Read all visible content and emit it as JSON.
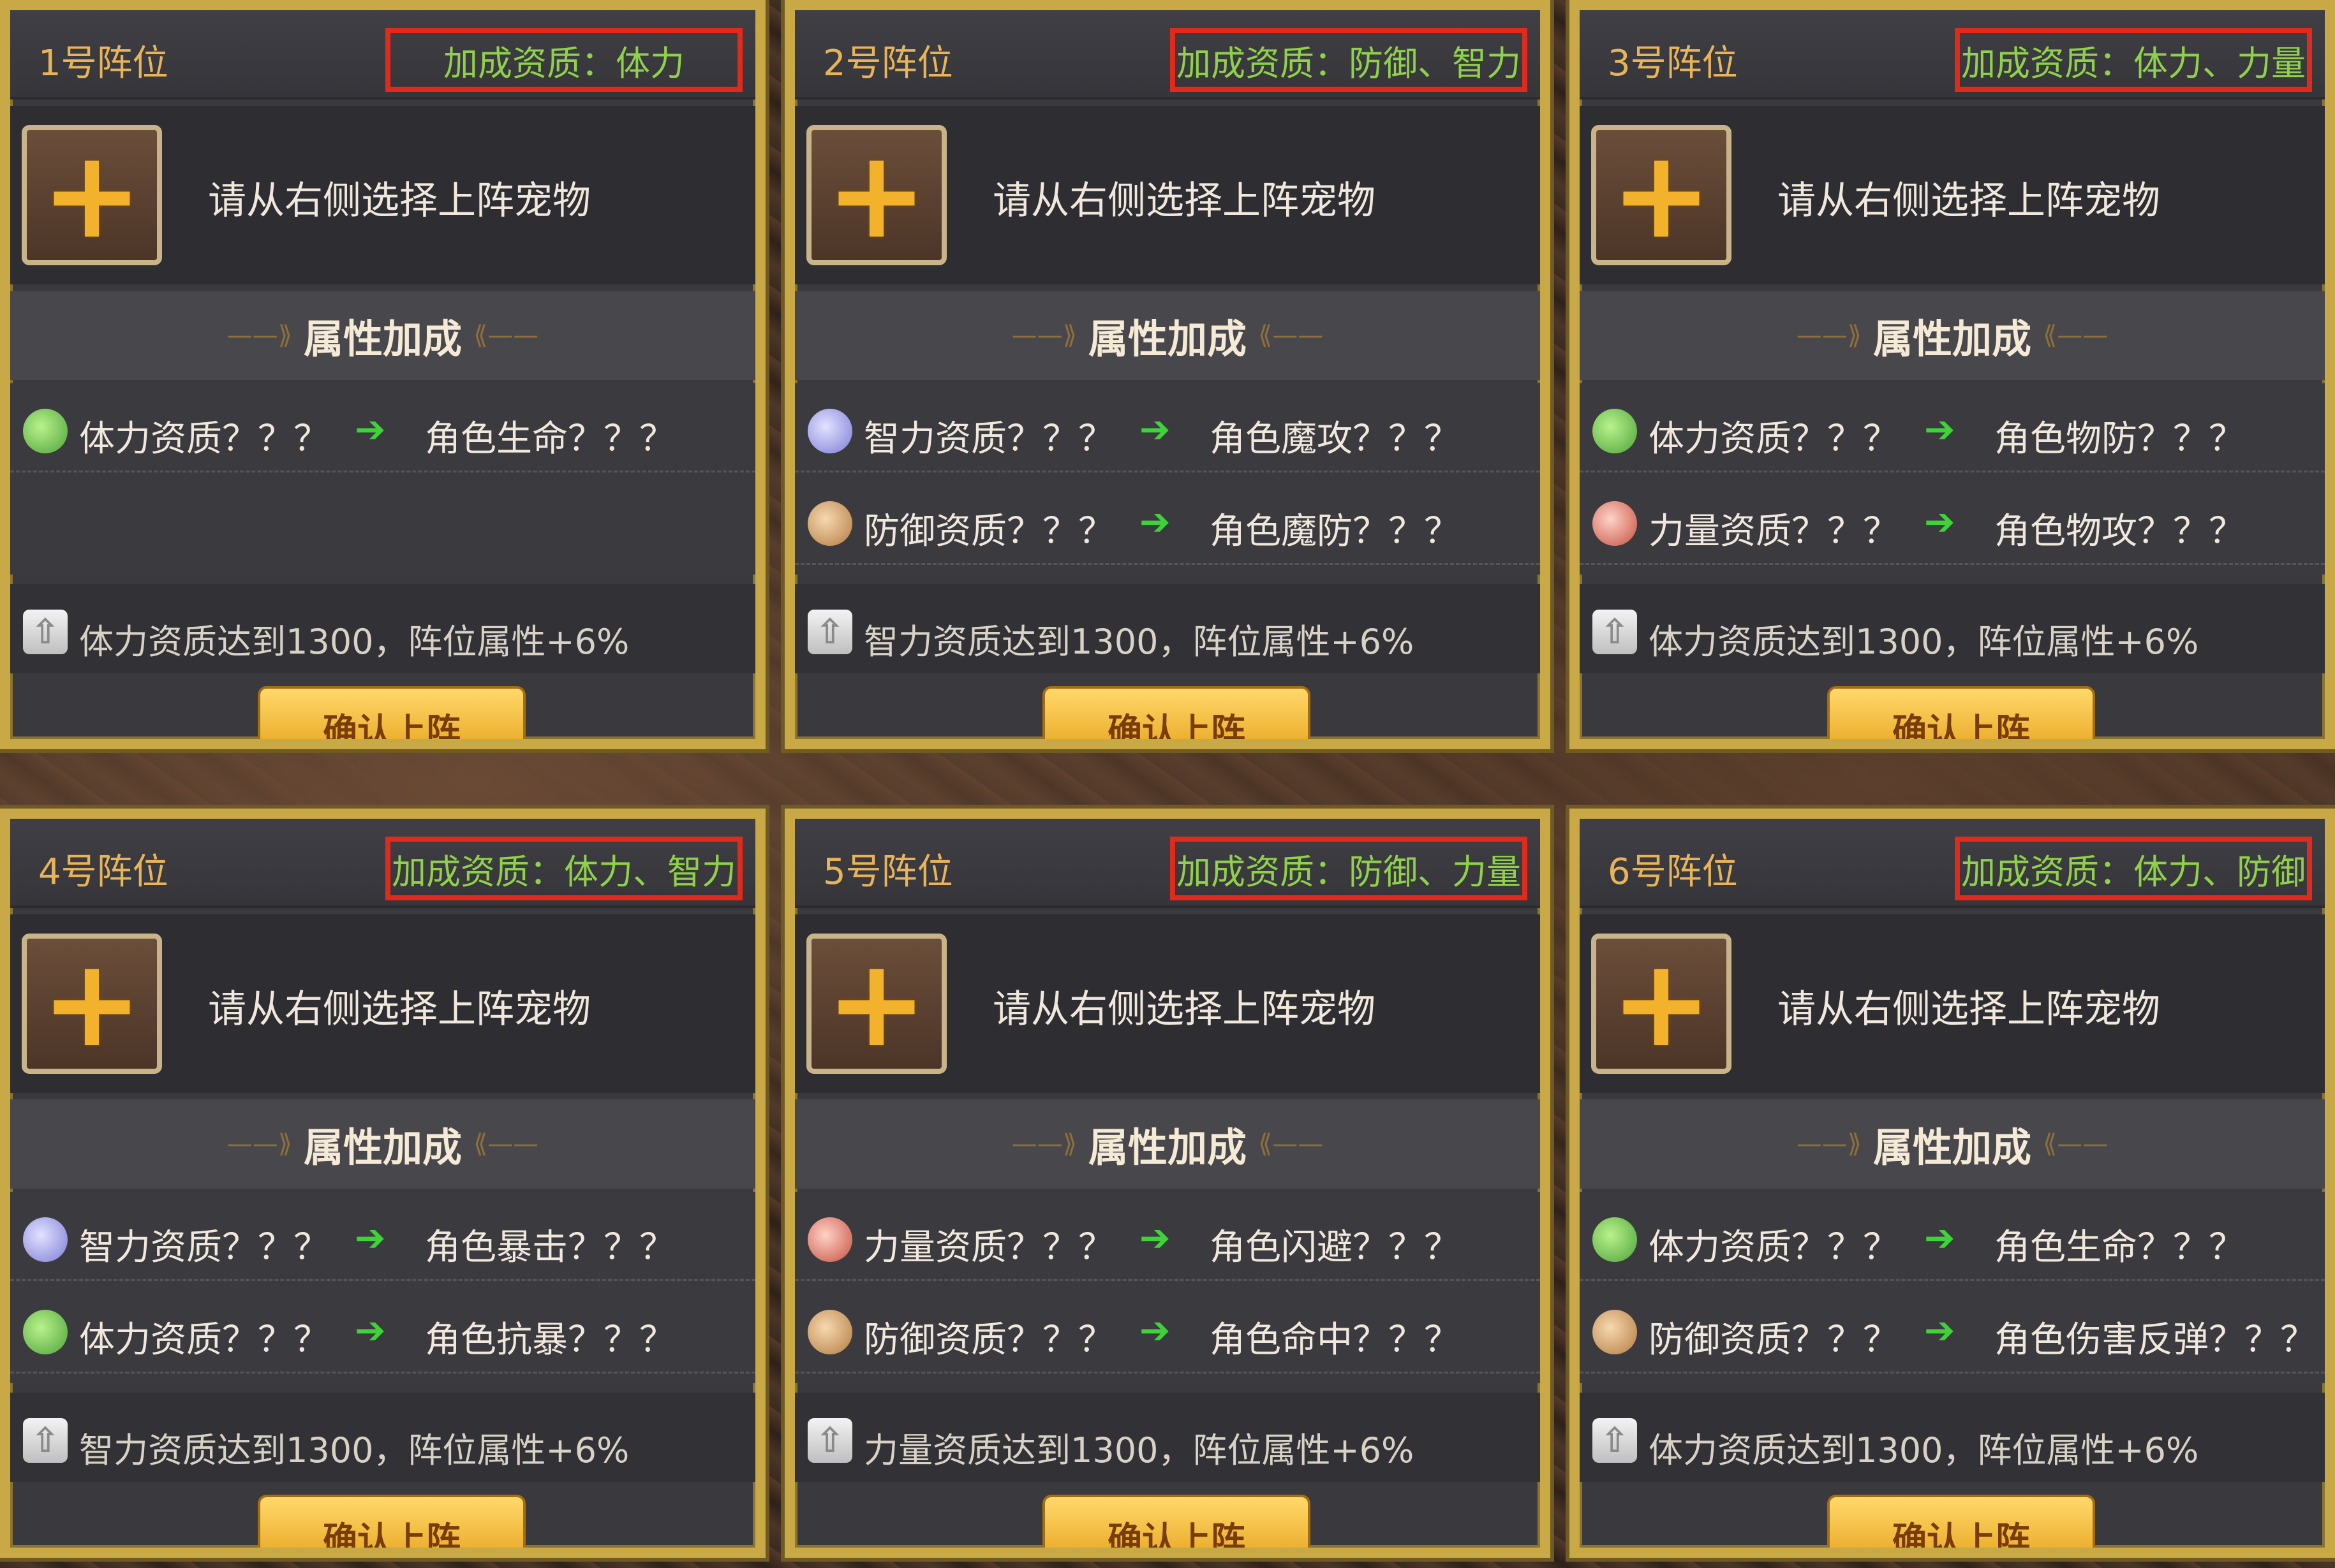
{
  "common": {
    "pet_hint": "请从右侧选择上阵宠物",
    "section_title": "属性加成",
    "arrow": "➔",
    "plus": "+",
    "up_glyph": "⇧",
    "confirm": "确认上阵",
    "ornament_left": "——⟫",
    "ornament_right": "⟪——"
  },
  "slots": [
    {
      "title": "1号阵位",
      "bonus": "加成资质：体力",
      "attrs": [
        {
          "name": "体力资质？？？",
          "target": "角色生命？？？",
          "icon": "heart-icon"
        }
      ],
      "note": "体力资质达到1300，阵位属性+6%"
    },
    {
      "title": "2号阵位",
      "bonus": "加成资质：防御、智力",
      "attrs": [
        {
          "name": "智力资质？？？",
          "target": "角色魔攻？？？",
          "icon": "flower-icon"
        },
        {
          "name": "防御资质？？？",
          "target": "角色魔防？？？",
          "icon": "shield-icon"
        }
      ],
      "note": "智力资质达到1300，阵位属性+6%"
    },
    {
      "title": "3号阵位",
      "bonus": "加成资质：体力、力量",
      "attrs": [
        {
          "name": "体力资质？？？",
          "target": "角色物防？？？",
          "icon": "heart-icon"
        },
        {
          "name": "力量资质？？？",
          "target": "角色物攻？？？",
          "icon": "sword-icon"
        }
      ],
      "note": "体力资质达到1300，阵位属性+6%"
    },
    {
      "title": "4号阵位",
      "bonus": "加成资质：体力、智力",
      "attrs": [
        {
          "name": "智力资质？？？",
          "target": "角色暴击？？？",
          "icon": "flower-icon"
        },
        {
          "name": "体力资质？？？",
          "target": "角色抗暴？？？",
          "icon": "heart-icon"
        }
      ],
      "note": "智力资质达到1300，阵位属性+6%"
    },
    {
      "title": "5号阵位",
      "bonus": "加成资质：防御、力量",
      "attrs": [
        {
          "name": "力量资质？？？",
          "target": "角色闪避？？？",
          "icon": "sword-icon"
        },
        {
          "name": "防御资质？？？",
          "target": "角色命中？？？",
          "icon": "shield-icon"
        }
      ],
      "note": "力量资质达到1300，阵位属性+6%"
    },
    {
      "title": "6号阵位",
      "bonus": "加成资质：体力、防御",
      "attrs": [
        {
          "name": "体力资质？？？",
          "target": "角色生命？？？",
          "icon": "heart-icon"
        },
        {
          "name": "防御资质？？？",
          "target": "角色伤害反弹？？？",
          "icon": "shield-icon"
        }
      ],
      "note": "体力资质达到1300，阵位属性+6%"
    }
  ],
  "colors": {
    "highlight_border": "#e02a1c",
    "bonus_text": "#8fd14a",
    "title_text": "#e8b45a",
    "arrow": "#3fd23a",
    "button": "#f2b22b"
  }
}
